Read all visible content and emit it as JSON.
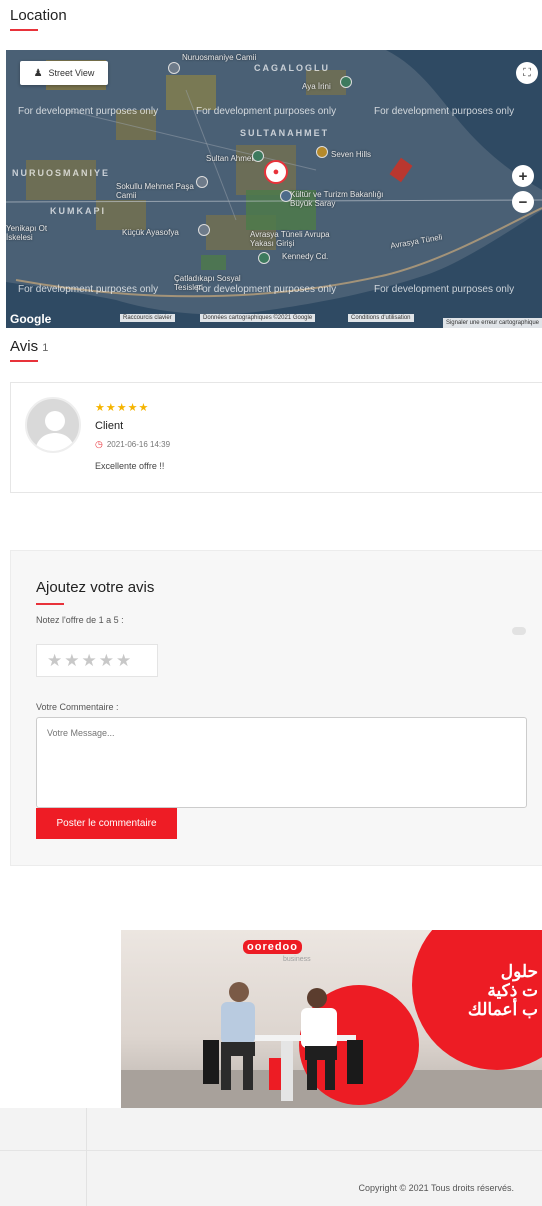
{
  "location": {
    "title": "Location"
  },
  "map": {
    "street_view_label": "Street View",
    "dev_notice": "For development purposes only",
    "labels": {
      "nuruosmaniye_camii": "Nuruosmaniye Camii",
      "cagaloglu": "CAGALOGLU",
      "aya_irini": "Aya İrini",
      "sultanahmet": "SULTANAHMET",
      "seven_hills": "Seven Hills",
      "sultan_ahmet": "Sultan Ahmet",
      "nuruosmaniye": "NURUOSMANIYE",
      "sokullu": "Sokullu Mehmet Paşa Camii",
      "kultur": "Kültür ve Turizm Bakanlığı Büyük Saray",
      "kumkapi": "KUMKAPI",
      "yenikapi": "Yenikapı Ot İskelesi",
      "kucuk": "Küçük Ayasofya",
      "avrasya": "Avrasya Tüneli Avrupa Yakası Girişi",
      "kennedy": "Kennedy Cd.",
      "catladikapi": "Çatladıkapı Sosyal Tesisleri",
      "avrasya_tuneli": "Avrasya Tüneli"
    },
    "google_logo": "Google",
    "footer_links": [
      "Raccourcis clavier",
      "Données cartographiques ©2021 Google",
      "Conditions d'utilisation"
    ],
    "report_link": "Signaler une erreur cartographique"
  },
  "reviews": {
    "title": "Avis",
    "count": "1",
    "items": [
      {
        "rating": 5,
        "stars": "★★★★★",
        "author": "Client",
        "date": "2021-06-16 14:39",
        "text": "Excellente offre !!"
      }
    ]
  },
  "add_review": {
    "title": "Ajoutez votre avis",
    "rate_label": "Notez l'offre de 1 a 5 :",
    "rating_selected": 0,
    "rating_max": 5,
    "comment_label": "Votre Commentaire :",
    "comment_placeholder": "Votre Message...",
    "submit_label": "Poster le commentaire"
  },
  "banner": {
    "brand": "ooredoo",
    "brand_sub": "business",
    "arabic_line1": "حلول",
    "arabic_line2": "ت ذكية",
    "arabic_line3": "ب أعمالك"
  },
  "footer": {
    "copyright": "Copyright © 2021 Tous droits réservés."
  },
  "colors": {
    "accent": "#e8323a",
    "button": "#ee1c25",
    "star": "#f5b400",
    "map_water": "#2f4a63"
  }
}
